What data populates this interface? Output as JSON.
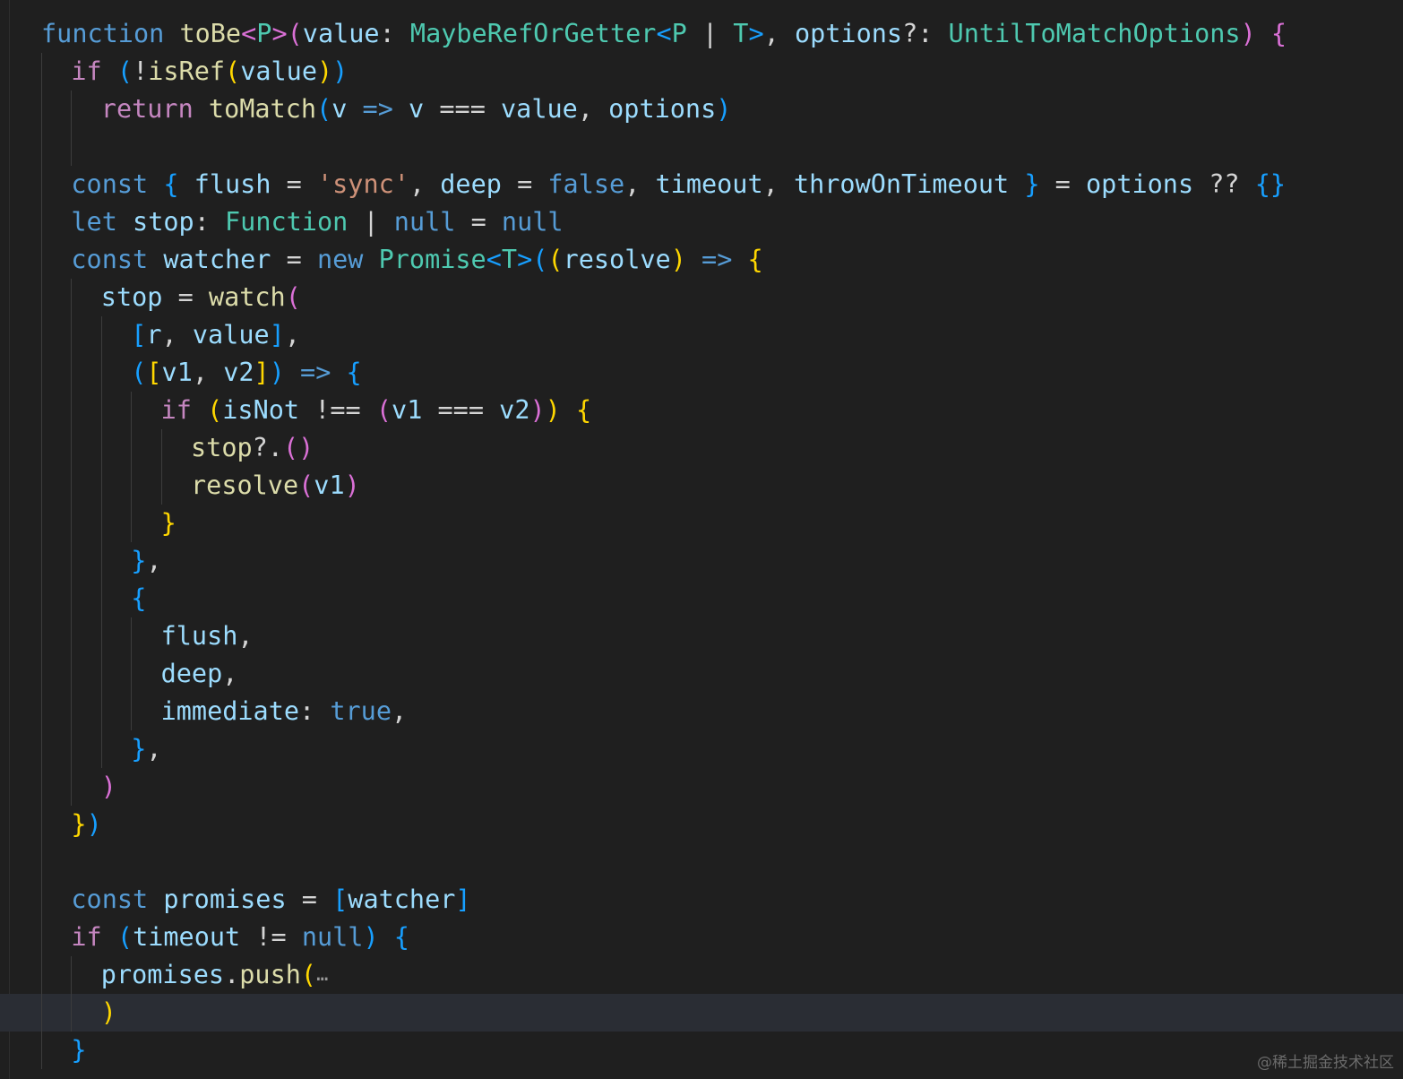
{
  "editor": {
    "highlighted_line": 26,
    "colors": {
      "background": "#1f1f1f",
      "keyword_storage": "#569cd6",
      "keyword_control": "#c586c0",
      "function": "#dcdcaa",
      "variable": "#9cdcfe",
      "type": "#4ec9b0",
      "string": "#ce9178",
      "plain": "#d4d4d4",
      "bracket_gold": "#ffd700",
      "bracket_pink": "#da70d6",
      "bracket_blue": "#179fff",
      "current_line": "#2a2d34",
      "indent_guide": "#3c3c3c"
    },
    "lines": [
      {
        "indent": 0,
        "tokens": [
          [
            "function",
            "storage"
          ],
          [
            " ",
            "plain"
          ],
          [
            "toBe",
            "func"
          ],
          [
            "<",
            "bpink"
          ],
          [
            "P",
            "type"
          ],
          [
            ">",
            "bpink"
          ],
          [
            "(",
            "bpink"
          ],
          [
            "value",
            "var"
          ],
          [
            ": ",
            "plain"
          ],
          [
            "MaybeRefOrGetter",
            "type"
          ],
          [
            "<",
            "bblue"
          ],
          [
            "P",
            "type"
          ],
          [
            " | ",
            "plain"
          ],
          [
            "T",
            "type"
          ],
          [
            ">",
            "bblue"
          ],
          [
            ", ",
            "plain"
          ],
          [
            "options",
            "var"
          ],
          [
            "?: ",
            "plain"
          ],
          [
            "UntilToMatchOptions",
            "type"
          ],
          [
            ")",
            "bpink"
          ],
          [
            " ",
            "plain"
          ],
          [
            "{",
            "bpink"
          ]
        ]
      },
      {
        "indent": 1,
        "tokens": [
          [
            "if",
            "control"
          ],
          [
            " ",
            "plain"
          ],
          [
            "(",
            "bblue"
          ],
          [
            "!",
            "plain"
          ],
          [
            "isRef",
            "func"
          ],
          [
            "(",
            "bgold"
          ],
          [
            "value",
            "var"
          ],
          [
            ")",
            "bgold"
          ],
          [
            ")",
            "bblue"
          ]
        ]
      },
      {
        "indent": 2,
        "tokens": [
          [
            "return",
            "control"
          ],
          [
            " ",
            "plain"
          ],
          [
            "toMatch",
            "func"
          ],
          [
            "(",
            "bblue"
          ],
          [
            "v",
            "var"
          ],
          [
            " ",
            "plain"
          ],
          [
            "=>",
            "storage"
          ],
          [
            " ",
            "plain"
          ],
          [
            "v",
            "var"
          ],
          [
            " === ",
            "plain"
          ],
          [
            "value",
            "var"
          ],
          [
            ", ",
            "plain"
          ],
          [
            "options",
            "var"
          ],
          [
            ")",
            "bblue"
          ]
        ]
      },
      {
        "indent": 2,
        "tokens": []
      },
      {
        "indent": 1,
        "tokens": [
          [
            "const",
            "storage"
          ],
          [
            " ",
            "plain"
          ],
          [
            "{",
            "bblue"
          ],
          [
            " ",
            "plain"
          ],
          [
            "flush",
            "var"
          ],
          [
            " = ",
            "plain"
          ],
          [
            "'sync'",
            "string"
          ],
          [
            ", ",
            "plain"
          ],
          [
            "deep",
            "var"
          ],
          [
            " = ",
            "plain"
          ],
          [
            "false",
            "storage"
          ],
          [
            ", ",
            "plain"
          ],
          [
            "timeout",
            "var"
          ],
          [
            ", ",
            "plain"
          ],
          [
            "throwOnTimeout",
            "var"
          ],
          [
            " ",
            "plain"
          ],
          [
            "}",
            "bblue"
          ],
          [
            " = ",
            "plain"
          ],
          [
            "options",
            "var"
          ],
          [
            " ?? ",
            "plain"
          ],
          [
            "{}",
            "bblue"
          ]
        ]
      },
      {
        "indent": 1,
        "tokens": [
          [
            "let",
            "storage"
          ],
          [
            " ",
            "plain"
          ],
          [
            "stop",
            "var"
          ],
          [
            ": ",
            "plain"
          ],
          [
            "Function",
            "type"
          ],
          [
            " | ",
            "plain"
          ],
          [
            "null",
            "storage"
          ],
          [
            " = ",
            "plain"
          ],
          [
            "null",
            "storage"
          ]
        ]
      },
      {
        "indent": 1,
        "tokens": [
          [
            "const",
            "storage"
          ],
          [
            " ",
            "plain"
          ],
          [
            "watcher",
            "var"
          ],
          [
            " = ",
            "plain"
          ],
          [
            "new",
            "storage"
          ],
          [
            " ",
            "plain"
          ],
          [
            "Promise",
            "type"
          ],
          [
            "<",
            "bblue"
          ],
          [
            "T",
            "type"
          ],
          [
            ">",
            "bblue"
          ],
          [
            "(",
            "bblue"
          ],
          [
            "(",
            "bgold"
          ],
          [
            "resolve",
            "var"
          ],
          [
            ")",
            "bgold"
          ],
          [
            " ",
            "plain"
          ],
          [
            "=>",
            "storage"
          ],
          [
            " ",
            "plain"
          ],
          [
            "{",
            "bgold"
          ]
        ]
      },
      {
        "indent": 2,
        "tokens": [
          [
            "stop",
            "var"
          ],
          [
            " = ",
            "plain"
          ],
          [
            "watch",
            "func"
          ],
          [
            "(",
            "bpink"
          ]
        ]
      },
      {
        "indent": 3,
        "tokens": [
          [
            "[",
            "bblue"
          ],
          [
            "r",
            "var"
          ],
          [
            ", ",
            "plain"
          ],
          [
            "value",
            "var"
          ],
          [
            "]",
            "bblue"
          ],
          [
            ",",
            "plain"
          ]
        ]
      },
      {
        "indent": 3,
        "tokens": [
          [
            "(",
            "bblue"
          ],
          [
            "[",
            "bgold"
          ],
          [
            "v1",
            "var"
          ],
          [
            ", ",
            "plain"
          ],
          [
            "v2",
            "var"
          ],
          [
            "]",
            "bgold"
          ],
          [
            ")",
            "bblue"
          ],
          [
            " ",
            "plain"
          ],
          [
            "=>",
            "storage"
          ],
          [
            " ",
            "plain"
          ],
          [
            "{",
            "bblue"
          ]
        ]
      },
      {
        "indent": 4,
        "tokens": [
          [
            "if",
            "control"
          ],
          [
            " ",
            "plain"
          ],
          [
            "(",
            "bgold"
          ],
          [
            "isNot",
            "var"
          ],
          [
            " !== ",
            "plain"
          ],
          [
            "(",
            "bpink"
          ],
          [
            "v1",
            "var"
          ],
          [
            " === ",
            "plain"
          ],
          [
            "v2",
            "var"
          ],
          [
            ")",
            "bpink"
          ],
          [
            ")",
            "bgold"
          ],
          [
            " ",
            "plain"
          ],
          [
            "{",
            "bgold"
          ]
        ]
      },
      {
        "indent": 5,
        "tokens": [
          [
            "stop",
            "func"
          ],
          [
            "?.",
            "plain"
          ],
          [
            "()",
            "bpink"
          ]
        ]
      },
      {
        "indent": 5,
        "tokens": [
          [
            "resolve",
            "func"
          ],
          [
            "(",
            "bpink"
          ],
          [
            "v1",
            "var"
          ],
          [
            ")",
            "bpink"
          ]
        ]
      },
      {
        "indent": 4,
        "tokens": [
          [
            "}",
            "bgold"
          ]
        ]
      },
      {
        "indent": 3,
        "tokens": [
          [
            "}",
            "bblue"
          ],
          [
            ",",
            "plain"
          ]
        ]
      },
      {
        "indent": 3,
        "tokens": [
          [
            "{",
            "bblue"
          ]
        ]
      },
      {
        "indent": 4,
        "tokens": [
          [
            "flush",
            "var"
          ],
          [
            ",",
            "plain"
          ]
        ]
      },
      {
        "indent": 4,
        "tokens": [
          [
            "deep",
            "var"
          ],
          [
            ",",
            "plain"
          ]
        ]
      },
      {
        "indent": 4,
        "tokens": [
          [
            "immediate",
            "var"
          ],
          [
            ": ",
            "plain"
          ],
          [
            "true",
            "storage"
          ],
          [
            ",",
            "plain"
          ]
        ]
      },
      {
        "indent": 3,
        "tokens": [
          [
            "}",
            "bblue"
          ],
          [
            ",",
            "plain"
          ]
        ]
      },
      {
        "indent": 2,
        "tokens": [
          [
            ")",
            "bpink"
          ]
        ]
      },
      {
        "indent": 1,
        "tokens": [
          [
            "}",
            "bgold"
          ],
          [
            ")",
            "bblue"
          ]
        ]
      },
      {
        "indent": 1,
        "tokens": []
      },
      {
        "indent": 1,
        "tokens": [
          [
            "const",
            "storage"
          ],
          [
            " ",
            "plain"
          ],
          [
            "promises",
            "var"
          ],
          [
            " = ",
            "plain"
          ],
          [
            "[watcher]",
            "bblue_text"
          ]
        ]
      },
      {
        "indent": 1,
        "tokens": [
          [
            "if",
            "control"
          ],
          [
            " ",
            "plain"
          ],
          [
            "(",
            "bblue"
          ],
          [
            "timeout",
            "var"
          ],
          [
            " != ",
            "plain"
          ],
          [
            "null",
            "storage"
          ],
          [
            ")",
            "bblue"
          ],
          [
            " ",
            "plain"
          ],
          [
            "{",
            "bblue"
          ]
        ]
      },
      {
        "indent": 2,
        "tokens": [
          [
            "promises",
            "var"
          ],
          [
            ".",
            "plain"
          ],
          [
            "push",
            "func"
          ],
          [
            "(",
            "bgold"
          ],
          [
            "…",
            "fold"
          ]
        ]
      },
      {
        "indent": 2,
        "tokens": [
          [
            ")",
            "bgold"
          ]
        ]
      },
      {
        "indent": 1,
        "tokens": [
          [
            "}",
            "bblue"
          ]
        ]
      }
    ]
  },
  "watermark": "@稀土掘金技术社区"
}
